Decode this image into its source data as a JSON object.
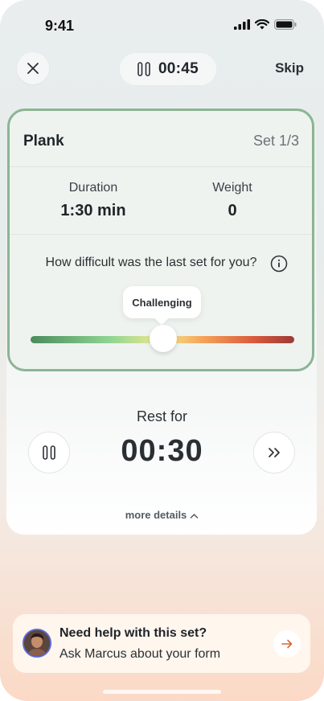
{
  "status_bar": {
    "time": "9:41"
  },
  "header": {
    "timer": "00:45",
    "skip_label": "Skip"
  },
  "exercise": {
    "name": "Plank",
    "set": "Set 1/3",
    "stats": [
      {
        "label": "Duration",
        "value": "1:30 min"
      },
      {
        "label": "Weight",
        "value": "0"
      }
    ],
    "difficulty_question": "How difficult was the last set for you?",
    "difficulty_value": "Challenging",
    "difficulty_level": 0.5,
    "slider_colors": [
      "#4a8c5c",
      "#8fd493",
      "#f3ea8f",
      "#f6a35a",
      "#d9593d",
      "#9b3a36"
    ]
  },
  "rest": {
    "label": "Rest for",
    "time": "00:30"
  },
  "more_details_label": "more details",
  "help": {
    "title": "Need help with this set?",
    "subtitle": "Ask Marcus about your form"
  },
  "colors": {
    "card_border": "#8cb494",
    "arrow_accent": "#d9663a"
  },
  "icons": [
    "close-icon",
    "pause-icon",
    "info-icon",
    "fast-forward-icon",
    "chevron-up-icon",
    "arrow-right-icon"
  ]
}
